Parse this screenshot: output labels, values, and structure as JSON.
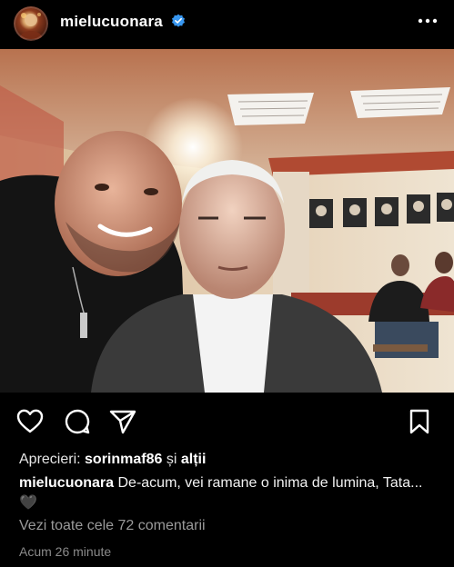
{
  "header": {
    "username": "mielucuonara",
    "avatar_icon": "profile-avatar",
    "verified_icon": "verified-badge-icon",
    "more_icon": "more-options-icon",
    "verified_color": "#3897f0"
  },
  "post": {
    "image_icon": "post-photo"
  },
  "actions": {
    "like_icon": "heart-icon",
    "comment_icon": "comment-icon",
    "share_icon": "send-icon",
    "save_icon": "bookmark-icon"
  },
  "likes": {
    "prefix": "Aprecieri:",
    "user": "sorinmaf86",
    "conj": "și",
    "others": "alții"
  },
  "caption": {
    "user": "mielucuonara",
    "text": "De-acum, vei ramane o inima de lumina, Tata...🖤"
  },
  "comments_link": "Vezi toate cele 72 comentarii",
  "timestamp": "Acum 26 minute"
}
